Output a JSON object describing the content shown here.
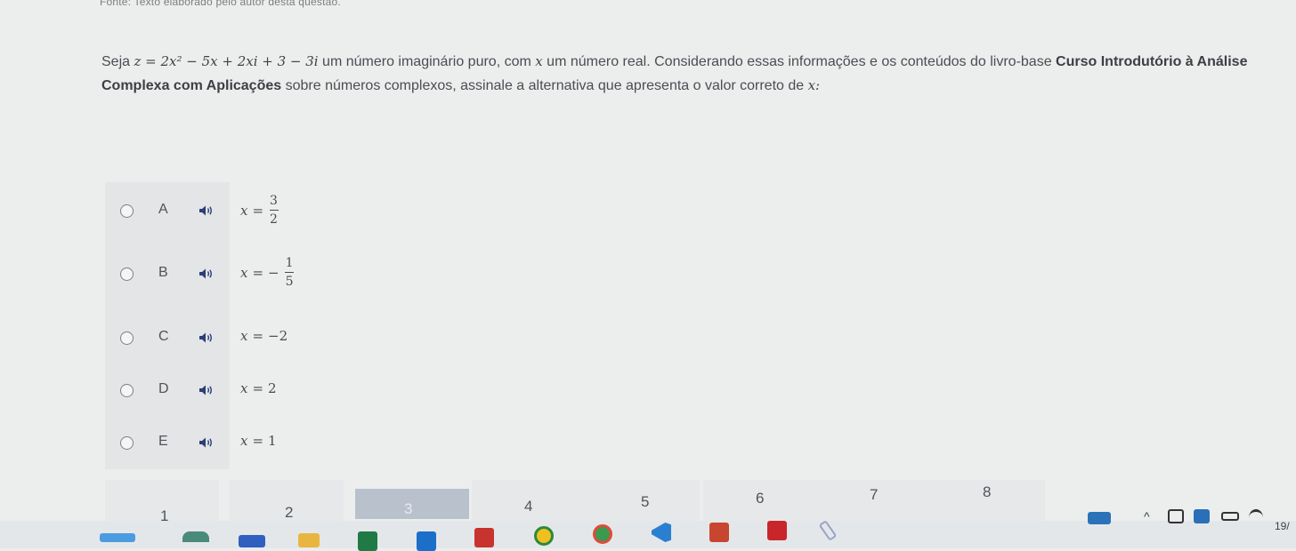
{
  "source_text": "Fonte: Texto elaborado pelo autor desta questão.",
  "question": {
    "intro": "Seja ",
    "formula": "z = 2x² − 5x + 2xi + 3 − 3i",
    "mid1": " um número imaginário puro, com ",
    "var_x": "x",
    "mid2": " um número real. Considerando essas informações e os conteúdos do livro-base ",
    "book_title": "Curso Introdutório à Análise Complexa com Aplicações",
    "tail": " sobre números complexos, assinale a alternativa que apresenta o valor correto de ",
    "end": "x:"
  },
  "options": [
    {
      "letter": "A",
      "var": "x",
      "eq": "=",
      "sign": "",
      "num": "3",
      "den": "2"
    },
    {
      "letter": "B",
      "var": "x",
      "eq": "=",
      "sign": "−",
      "num": "1",
      "den": "5"
    },
    {
      "letter": "C",
      "var": "x",
      "eq": "=",
      "value": "−2"
    },
    {
      "letter": "D",
      "var": "x",
      "eq": "=",
      "value": "2"
    },
    {
      "letter": "E",
      "var": "x",
      "eq": "=",
      "value": "1"
    }
  ],
  "pages": [
    "1",
    "2",
    "3",
    "4",
    "5",
    "6",
    "7",
    "8"
  ],
  "active_page": "3",
  "taskbar": {
    "tray_caret": "^",
    "clock_fragment": "19/"
  },
  "colors": {
    "background": "#eceeee",
    "options_panel": "#e3e5e6",
    "active_page": "#b9c1cd",
    "speaker_blue": "#2c3f7a"
  }
}
